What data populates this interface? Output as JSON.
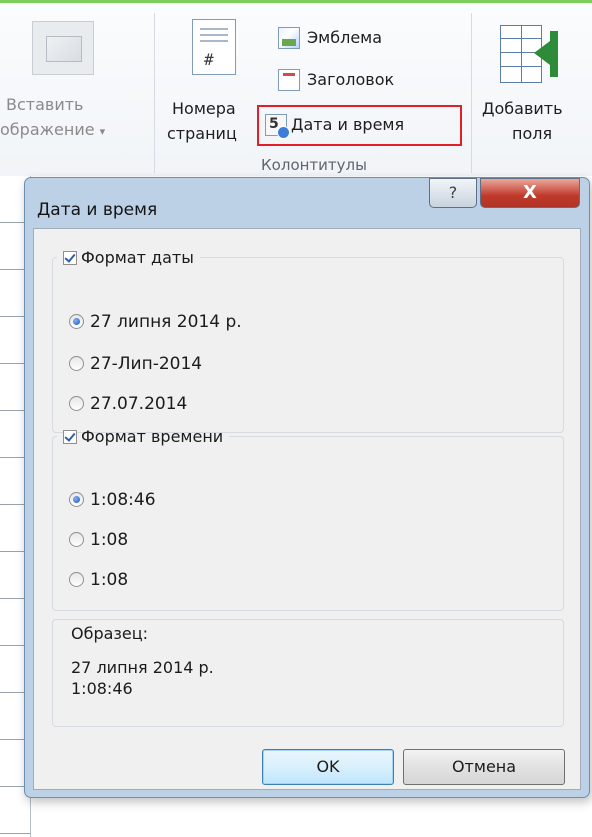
{
  "ribbon": {
    "insert_picture_line1": "Вставить",
    "insert_picture_line2": "ображение",
    "page_numbers_line1": "Номера",
    "page_numbers_line2": "страниц",
    "emblem_label": "Эмблема",
    "header_label": "Заголовок",
    "date_time_label": "Дата и время",
    "add_fields_line1": "Добавить",
    "add_fields_line2": "поля",
    "group_label": "Колонтитулы",
    "icons": {
      "insert_picture": "picture-icon",
      "page_numbers": "page-number-icon",
      "emblem": "emblem-icon",
      "header": "header-icon",
      "date_time": "calendar-clock-icon",
      "add_fields": "add-fields-icon"
    },
    "highlight_color": "#e21f26"
  },
  "dialog": {
    "title": "Дата и время",
    "help_glyph": "?",
    "close_glyph": "X",
    "date_format": {
      "label": "Формат даты",
      "checked": true,
      "options": [
        "27 липня 2014 р.",
        "27-Лип-2014",
        "27.07.2014"
      ],
      "selected_index": 0
    },
    "time_format": {
      "label": "Формат времени",
      "checked": true,
      "options": [
        "1:08:46",
        "1:08",
        "1:08"
      ],
      "selected_index": 0
    },
    "sample": {
      "label": "Образец:",
      "line1": "27 липня 2014 р.",
      "line2": "1:08:46"
    },
    "ok_label": "OK",
    "cancel_label": "Отмена"
  }
}
